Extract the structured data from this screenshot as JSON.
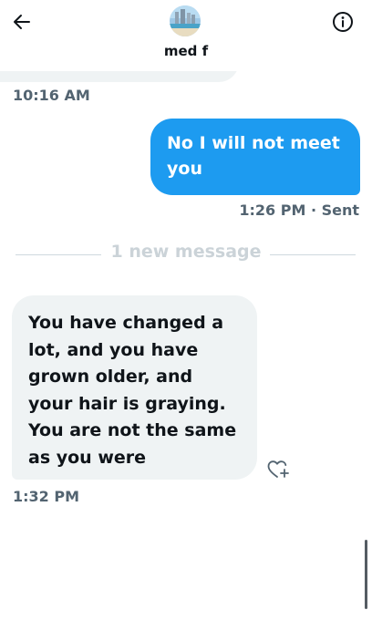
{
  "header": {
    "contact_name": "med f",
    "back_icon": "arrow-left-icon",
    "info_icon": "info-icon"
  },
  "messages": [
    {
      "direction": "in",
      "time": "10:16 AM"
    },
    {
      "direction": "out",
      "text": "No I will not meet you",
      "time": "1:26 PM",
      "status": "· Sent"
    },
    {
      "divider": "1 new message"
    },
    {
      "direction": "in",
      "text": "You have changed a lot, and you have grown older, and your hair is graying. You are not the same as you were",
      "time": "1:32 PM"
    }
  ],
  "colors": {
    "outgoing_bubble": "#1d9bf0",
    "incoming_bubble": "#eff3f4",
    "timestamp": "#536471"
  }
}
